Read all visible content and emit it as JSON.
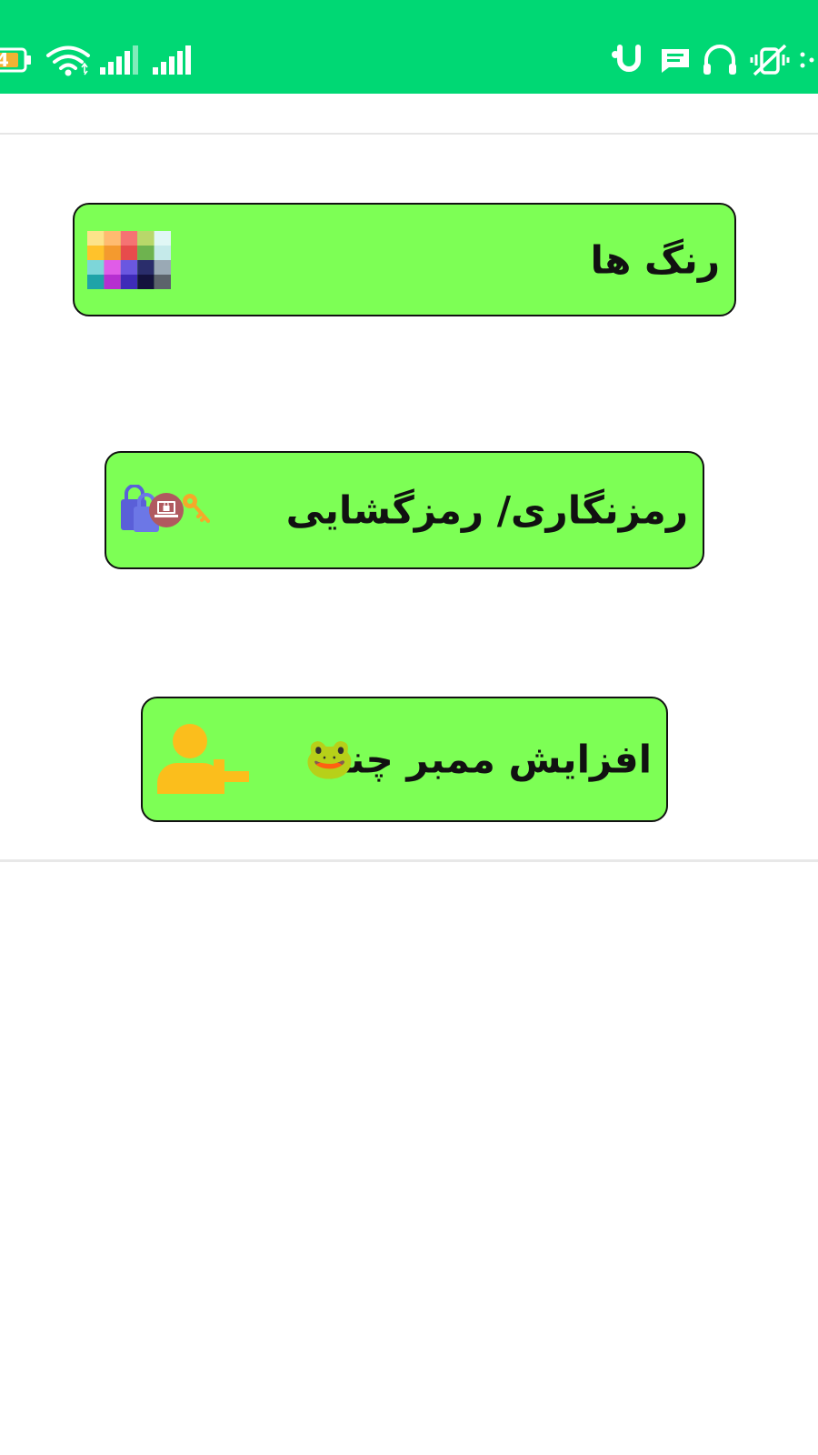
{
  "status_bar": {
    "battery_level": "4",
    "background": "#00d874",
    "left_icons": [
      "battery-icon",
      "wifi-icon",
      "signal-icon",
      "signal-icon"
    ],
    "right_icons": [
      "app-u-icon",
      "message-icon",
      "headphones-icon",
      "vibrate-off-icon",
      "more-dots-icon"
    ]
  },
  "menu": {
    "colors_label": "رنگ ها",
    "encrypt_label": "رمزنگاری/ رمزگشایی",
    "members_label": "افزایش ممبر چنل",
    "members_emoji": "🐸",
    "button_color": "#7dff55",
    "icons": [
      "color-palette-icon",
      "lock-key-icon",
      "add-user-icon"
    ]
  }
}
